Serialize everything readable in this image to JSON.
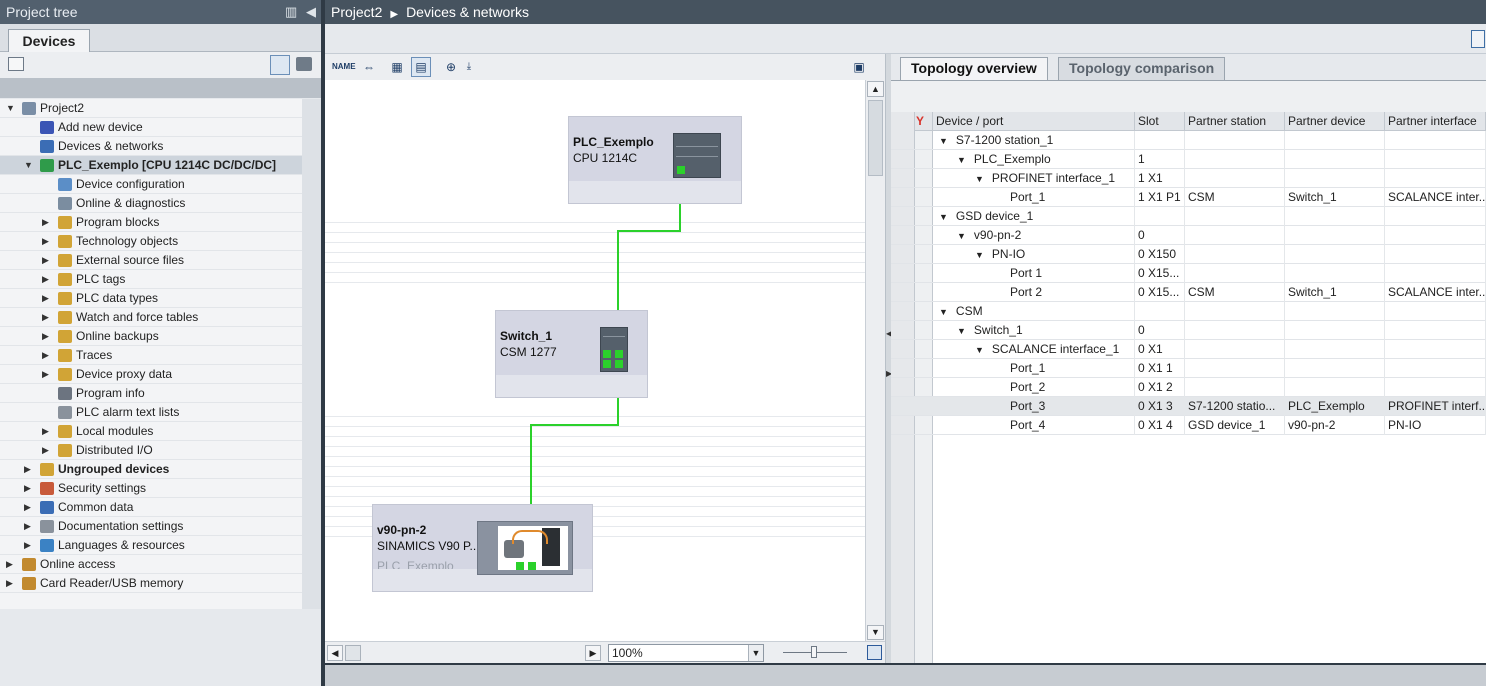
{
  "project_tree": {
    "title": "Project tree",
    "tab": "Devices",
    "items": [
      {
        "label": "Project2",
        "level": 0,
        "expand": "open",
        "icon": "project-icon",
        "color": "#7a8ea6",
        "bold": false
      },
      {
        "label": "Add new device",
        "level": 1,
        "expand": "none",
        "icon": "add-device-icon",
        "color": "#3b55b5",
        "bold": false
      },
      {
        "label": "Devices & networks",
        "level": 1,
        "expand": "none",
        "icon": "network-icon",
        "color": "#3b6db5",
        "bold": false
      },
      {
        "label": "PLC_Exemplo [CPU 1214C DC/DC/DC]",
        "level": 1,
        "expand": "open",
        "icon": "plc-icon",
        "color": "#2f9b4a",
        "bold": true
      },
      {
        "label": "Device configuration",
        "level": 2,
        "expand": "none",
        "icon": "device-config-icon",
        "color": "#5b8ec7",
        "bold": false
      },
      {
        "label": "Online & diagnostics",
        "level": 2,
        "expand": "none",
        "icon": "diagnostics-icon",
        "color": "#7b8da0",
        "bold": false
      },
      {
        "label": "Program blocks",
        "level": 2,
        "expand": "closed",
        "icon": "folder-icon",
        "color": "#d1a436",
        "bold": false
      },
      {
        "label": "Technology objects",
        "level": 2,
        "expand": "closed",
        "icon": "folder-icon",
        "color": "#d1a436",
        "bold": false
      },
      {
        "label": "External source files",
        "level": 2,
        "expand": "closed",
        "icon": "folder-icon",
        "color": "#d1a436",
        "bold": false
      },
      {
        "label": "PLC tags",
        "level": 2,
        "expand": "closed",
        "icon": "folder-icon",
        "color": "#d1a436",
        "bold": false
      },
      {
        "label": "PLC data types",
        "level": 2,
        "expand": "closed",
        "icon": "folder-icon",
        "color": "#d1a436",
        "bold": false
      },
      {
        "label": "Watch and force tables",
        "level": 2,
        "expand": "closed",
        "icon": "folder-icon",
        "color": "#d1a436",
        "bold": false
      },
      {
        "label": "Online backups",
        "level": 2,
        "expand": "closed",
        "icon": "folder-icon",
        "color": "#d1a436",
        "bold": false
      },
      {
        "label": "Traces",
        "level": 2,
        "expand": "closed",
        "icon": "folder-icon",
        "color": "#d1a436",
        "bold": false
      },
      {
        "label": "Device proxy data",
        "level": 2,
        "expand": "closed",
        "icon": "folder-icon",
        "color": "#d1a436",
        "bold": false
      },
      {
        "label": "Program info",
        "level": 2,
        "expand": "none",
        "icon": "program-info-icon",
        "color": "#6c7480",
        "bold": false
      },
      {
        "label": "PLC alarm text lists",
        "level": 2,
        "expand": "none",
        "icon": "alarm-text-icon",
        "color": "#8a929c",
        "bold": false
      },
      {
        "label": "Local modules",
        "level": 2,
        "expand": "closed",
        "icon": "folder-icon",
        "color": "#d1a436",
        "bold": false
      },
      {
        "label": "Distributed I/O",
        "level": 2,
        "expand": "closed",
        "icon": "folder-icon",
        "color": "#d1a436",
        "bold": false
      },
      {
        "label": "Ungrouped devices",
        "level": 1,
        "expand": "closed",
        "icon": "folder-icon",
        "color": "#d1a436",
        "bold": true
      },
      {
        "label": "Security settings",
        "level": 1,
        "expand": "closed",
        "icon": "security-icon",
        "color": "#c85a3a",
        "bold": false
      },
      {
        "label": "Common data",
        "level": 1,
        "expand": "closed",
        "icon": "common-data-icon",
        "color": "#3b6db5",
        "bold": false
      },
      {
        "label": "Documentation settings",
        "level": 1,
        "expand": "closed",
        "icon": "documentation-icon",
        "color": "#8a929c",
        "bold": false
      },
      {
        "label": "Languages & resources",
        "level": 1,
        "expand": "closed",
        "icon": "languages-icon",
        "color": "#3b82c4",
        "bold": false
      },
      {
        "label": "Online access",
        "level": 0,
        "expand": "closed",
        "icon": "online-access-icon",
        "color": "#c28a2f",
        "bold": false
      },
      {
        "label": "Card Reader/USB memory",
        "level": 0,
        "expand": "closed",
        "icon": "card-reader-icon",
        "color": "#c28a2f",
        "bold": false
      }
    ]
  },
  "breadcrumb": {
    "root": "Project2",
    "current": "Devices & networks"
  },
  "canvas": {
    "zoom": "100%",
    "devices": [
      {
        "name": "PLC_Exemplo",
        "type": "CPU 1214C",
        "master": ""
      },
      {
        "name": "Switch_1",
        "type": "CSM 1277",
        "master": ""
      },
      {
        "name": "v90-pn-2",
        "type": "SINAMICS V90 P...",
        "master": "PLC_Exemplo"
      }
    ]
  },
  "topology": {
    "tabs": [
      "Topology overview",
      "Topology comparison"
    ],
    "columns": [
      "Device / port",
      "Slot",
      "Partner station",
      "Partner device",
      "Partner interface"
    ],
    "rows": [
      {
        "level": 0,
        "expand": "open",
        "name": "S7-1200 station_1",
        "slot": "",
        "station": "",
        "device": "",
        "iface": "",
        "hl": false
      },
      {
        "level": 1,
        "expand": "open",
        "name": "PLC_Exemplo",
        "slot": "1",
        "station": "",
        "device": "",
        "iface": "",
        "hl": false
      },
      {
        "level": 2,
        "expand": "open",
        "name": "PROFINET interface_1",
        "slot": "1 X1",
        "station": "",
        "device": "",
        "iface": "",
        "hl": false
      },
      {
        "level": 3,
        "expand": "none",
        "name": "Port_1",
        "slot": "1 X1 P1",
        "station": "CSM",
        "device": "Switch_1",
        "iface": "SCALANCE inter...",
        "hl": false
      },
      {
        "level": 0,
        "expand": "open",
        "name": "GSD device_1",
        "slot": "",
        "station": "",
        "device": "",
        "iface": "",
        "hl": false
      },
      {
        "level": 1,
        "expand": "open",
        "name": "v90-pn-2",
        "slot": "0",
        "station": "",
        "device": "",
        "iface": "",
        "hl": false
      },
      {
        "level": 2,
        "expand": "open",
        "name": "PN-IO",
        "slot": "0 X150",
        "station": "",
        "device": "",
        "iface": "",
        "hl": false
      },
      {
        "level": 3,
        "expand": "none",
        "name": "Port 1",
        "slot": "0 X15...",
        "station": "",
        "device": "",
        "iface": "",
        "hl": false
      },
      {
        "level": 3,
        "expand": "none",
        "name": "Port 2",
        "slot": "0 X15...",
        "station": "CSM",
        "device": "Switch_1",
        "iface": "SCALANCE inter...",
        "hl": false
      },
      {
        "level": 0,
        "expand": "open",
        "name": "CSM",
        "slot": "",
        "station": "",
        "device": "",
        "iface": "",
        "hl": false
      },
      {
        "level": 1,
        "expand": "open",
        "name": "Switch_1",
        "slot": "0",
        "station": "",
        "device": "",
        "iface": "",
        "hl": false
      },
      {
        "level": 2,
        "expand": "open",
        "name": "SCALANCE interface_1",
        "slot": "0 X1",
        "station": "",
        "device": "",
        "iface": "",
        "hl": false
      },
      {
        "level": 3,
        "expand": "none",
        "name": "Port_1",
        "slot": "0 X1 1",
        "station": "",
        "device": "",
        "iface": "",
        "hl": false
      },
      {
        "level": 3,
        "expand": "none",
        "name": "Port_2",
        "slot": "0 X1 2",
        "station": "",
        "device": "",
        "iface": "",
        "hl": false
      },
      {
        "level": 3,
        "expand": "none",
        "name": "Port_3",
        "slot": "0 X1 3",
        "station": "S7-1200 statio...",
        "device": "PLC_Exemplo",
        "iface": "PROFINET interf...",
        "hl": true
      },
      {
        "level": 3,
        "expand": "none",
        "name": "Port_4",
        "slot": "0 X1 4",
        "station": "GSD device_1",
        "device": "v90-pn-2",
        "iface": "PN-IO",
        "hl": false
      }
    ]
  },
  "colors": {
    "link": "#2bd12b",
    "header": "#52606e",
    "breadcrumb": "#46535f"
  }
}
